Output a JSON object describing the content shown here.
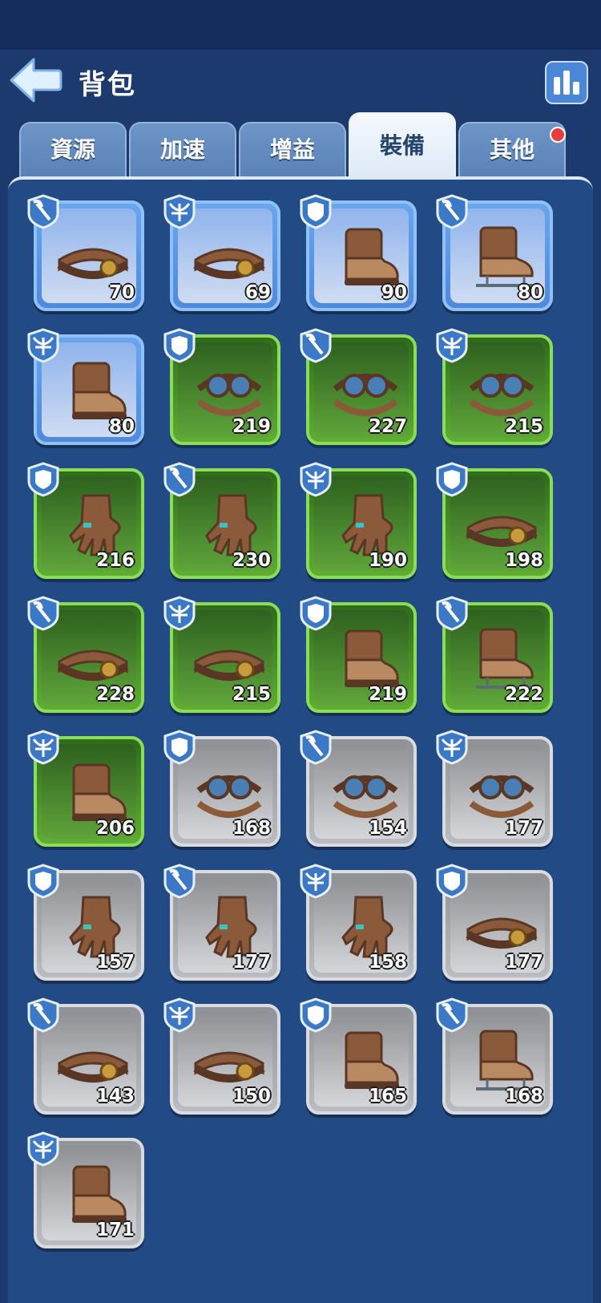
{
  "header": {
    "title": "背包"
  },
  "tabs": [
    {
      "label": "資源",
      "active": false
    },
    {
      "label": "加速",
      "active": false
    },
    {
      "label": "增益",
      "active": false
    },
    {
      "label": "裝備",
      "active": true
    },
    {
      "label": "其他",
      "active": false,
      "notify": true
    }
  ],
  "items": [
    {
      "rarity": "blue",
      "type": "pick",
      "icon": "belt-icon",
      "qty": "70"
    },
    {
      "rarity": "blue",
      "type": "crossbow",
      "icon": "belt-icon",
      "qty": "69"
    },
    {
      "rarity": "blue",
      "type": "shield",
      "icon": "boot-icon",
      "qty": "90"
    },
    {
      "rarity": "blue",
      "type": "pick",
      "icon": "skate-boot-icon",
      "qty": "80"
    },
    {
      "rarity": "blue",
      "type": "crossbow",
      "icon": "boot-icon",
      "qty": "80"
    },
    {
      "rarity": "green",
      "type": "shield",
      "icon": "goggles-icon",
      "qty": "219"
    },
    {
      "rarity": "green",
      "type": "pick",
      "icon": "goggles-icon",
      "qty": "227"
    },
    {
      "rarity": "green",
      "type": "crossbow",
      "icon": "goggles-icon",
      "qty": "215"
    },
    {
      "rarity": "green",
      "type": "shield",
      "icon": "glove-icon",
      "qty": "216"
    },
    {
      "rarity": "green",
      "type": "pick",
      "icon": "glove-icon",
      "qty": "230"
    },
    {
      "rarity": "green",
      "type": "crossbow",
      "icon": "glove-icon",
      "qty": "190"
    },
    {
      "rarity": "green",
      "type": "shield",
      "icon": "belt-icon",
      "qty": "198"
    },
    {
      "rarity": "green",
      "type": "pick",
      "icon": "belt-icon",
      "qty": "228"
    },
    {
      "rarity": "green",
      "type": "crossbow",
      "icon": "belt-icon",
      "qty": "215"
    },
    {
      "rarity": "green",
      "type": "shield",
      "icon": "boot-icon",
      "qty": "219"
    },
    {
      "rarity": "green",
      "type": "pick",
      "icon": "skate-boot-icon",
      "qty": "222"
    },
    {
      "rarity": "green",
      "type": "crossbow",
      "icon": "boot-icon",
      "qty": "206"
    },
    {
      "rarity": "gray",
      "type": "shield",
      "icon": "goggles-icon",
      "qty": "168"
    },
    {
      "rarity": "gray",
      "type": "pick",
      "icon": "goggles-icon",
      "qty": "154"
    },
    {
      "rarity": "gray",
      "type": "crossbow",
      "icon": "goggles-icon",
      "qty": "177"
    },
    {
      "rarity": "gray",
      "type": "shield",
      "icon": "glove-icon",
      "qty": "157"
    },
    {
      "rarity": "gray",
      "type": "pick",
      "icon": "glove-icon",
      "qty": "177"
    },
    {
      "rarity": "gray",
      "type": "crossbow",
      "icon": "glove-icon",
      "qty": "158"
    },
    {
      "rarity": "gray",
      "type": "shield",
      "icon": "belt-icon",
      "qty": "177"
    },
    {
      "rarity": "gray",
      "type": "pick",
      "icon": "belt-icon",
      "qty": "143"
    },
    {
      "rarity": "gray",
      "type": "crossbow",
      "icon": "belt-icon",
      "qty": "150"
    },
    {
      "rarity": "gray",
      "type": "shield",
      "icon": "boot-icon",
      "qty": "165"
    },
    {
      "rarity": "gray",
      "type": "pick",
      "icon": "skate-boot-icon",
      "qty": "168"
    },
    {
      "rarity": "gray",
      "type": "crossbow",
      "icon": "boot-icon",
      "qty": "171"
    }
  ]
}
